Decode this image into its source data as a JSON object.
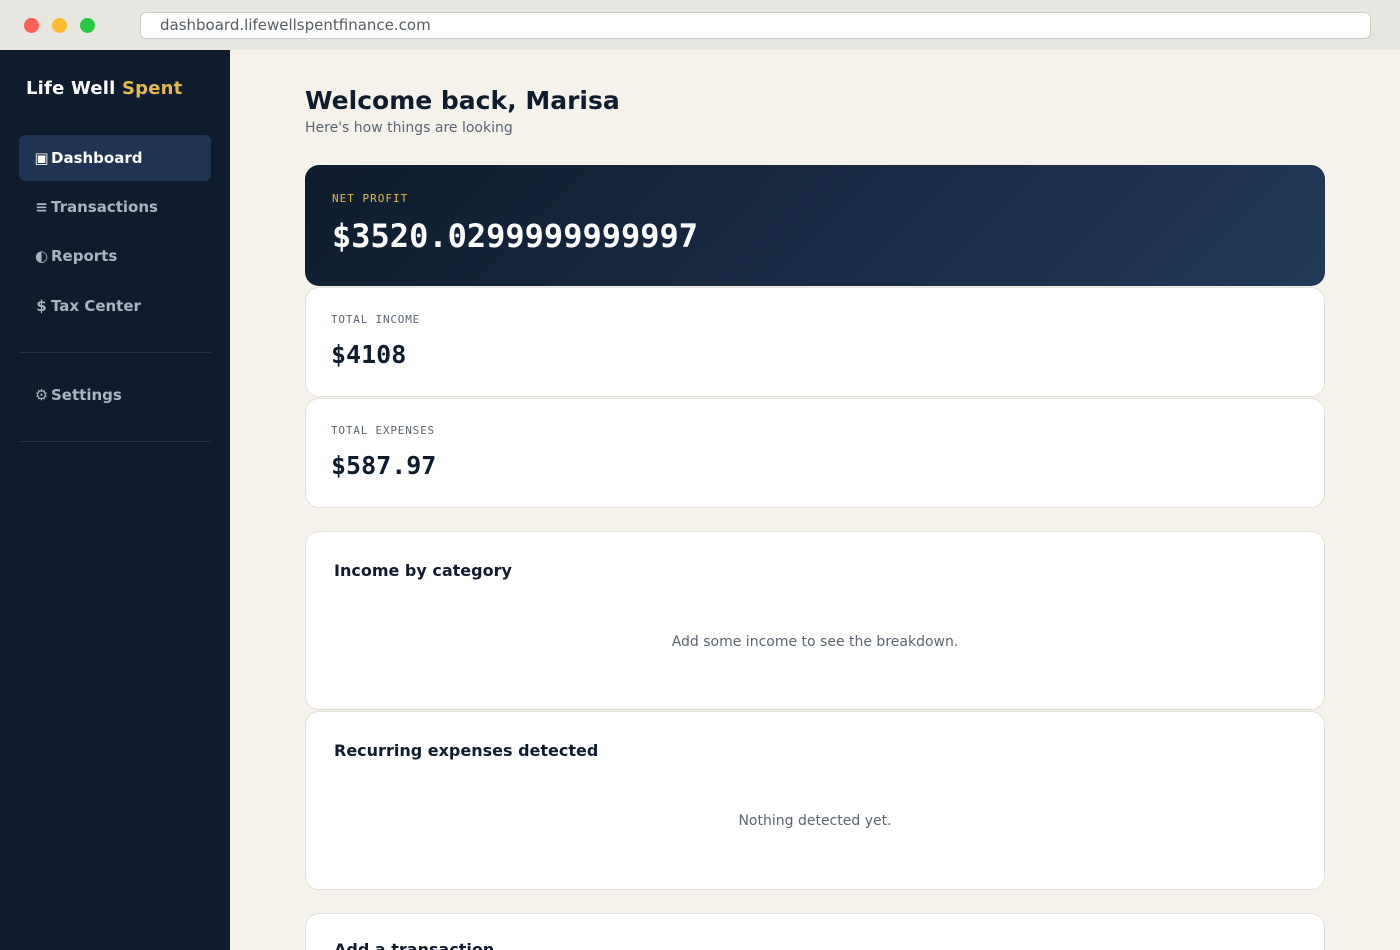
{
  "browser": {
    "url": "dashboard.lifewellspentfinance.com"
  },
  "brand": {
    "name_part1": "Life Well",
    "name_part2": "Spent"
  },
  "sidebar": {
    "items": [
      {
        "icon": "▣",
        "label": "Dashboard",
        "icon_name": "dashboard-icon",
        "active": true
      },
      {
        "icon": "≡",
        "label": "Transactions",
        "icon_name": "list-icon"
      },
      {
        "icon": "◐",
        "label": "Reports",
        "icon_name": "reports-icon"
      },
      {
        "icon": "$",
        "label": "Tax Center",
        "icon_name": "dollar-icon"
      },
      {
        "icon": "⚙",
        "label": "Settings",
        "icon_name": "gear-icon"
      }
    ]
  },
  "header": {
    "welcome": "Welcome back, Marisa",
    "subtitle": "Here's how things are looking"
  },
  "summary": {
    "net_profit_label": "NET PROFIT",
    "net_profit_value": "$3520.0299999999997",
    "total_income_label": "TOTAL INCOME",
    "total_income_value": "$4108",
    "total_expenses_label": "TOTAL EXPENSES",
    "total_expenses_value": "$587.97"
  },
  "sections": {
    "income_by_category": {
      "title": "Income by category",
      "empty_text": "Add some income to see the breakdown."
    },
    "recurring_expenses": {
      "title": "Recurring expenses detected",
      "empty_text": "Nothing detected yet."
    },
    "add_transaction": {
      "title": "Add a transaction"
    }
  },
  "colors": {
    "sidebar_bg": "#0f1c2e",
    "accent_gold": "#e3b94e",
    "page_bg": "#f5f2ec",
    "active_nav_bg": "#1e3452"
  }
}
